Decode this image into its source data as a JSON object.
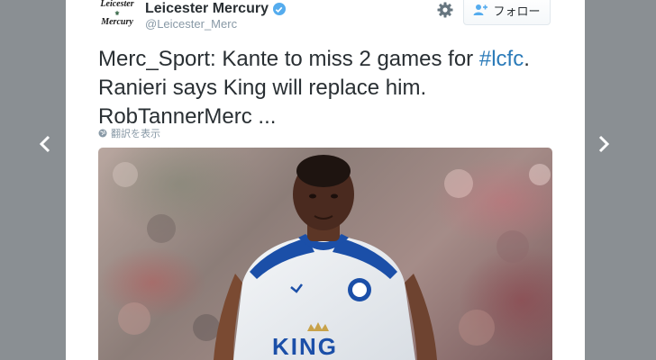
{
  "tweet": {
    "avatar_line1": "Leicester",
    "avatar_line2": "Mercury",
    "display_name": "Leicester Mercury",
    "handle": "@Leicester_Merc",
    "follow_label": "フォロー",
    "text_before": "Merc_Sport: Kante to miss 2 games for ",
    "hashtag": "#lcfc",
    "text_after": ". Ranieri says King will replace him. RobTannerMerc ...",
    "translate_label": "翻訳を表示",
    "media_sponsor_text": "KING"
  },
  "colors": {
    "backdrop": "#8a8f93",
    "link": "#2b7bb9",
    "verified": "#55acee",
    "muted": "#8899a6",
    "kit_blue": "#1b4fa8"
  },
  "icons": [
    "chevron-left-icon",
    "chevron-right-icon",
    "verified-badge-icon",
    "gear-icon",
    "follow-user-icon",
    "globe-icon",
    "crest-icon"
  ]
}
